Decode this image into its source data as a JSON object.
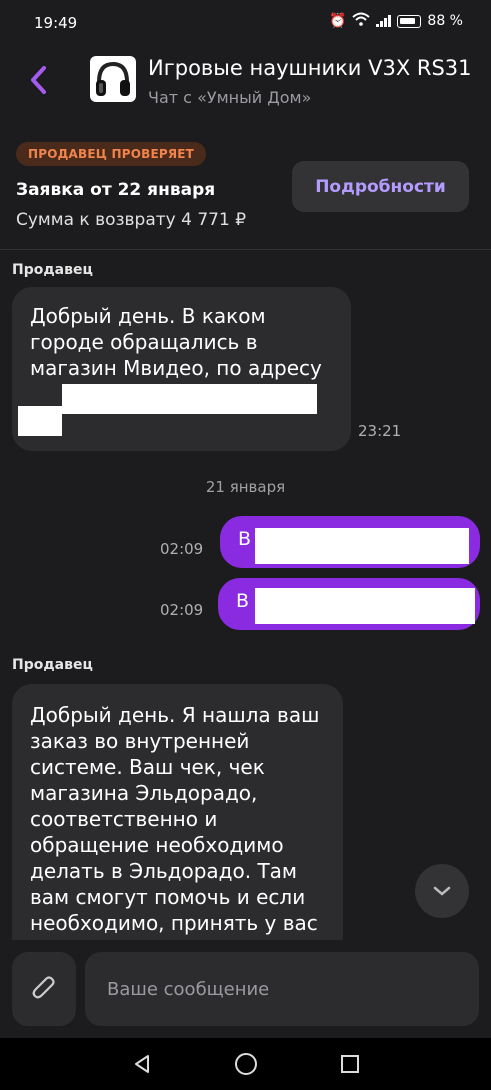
{
  "status_bar": {
    "time": "19:49",
    "battery": "88 %"
  },
  "header": {
    "title": "Игровые наушники V3X RS31",
    "subtitle": "Чат с «Умный Дом»"
  },
  "claim": {
    "badge": "ПРОДАВЕЦ ПРОВЕРЯЕТ",
    "title": "Заявка от 22 января",
    "refund": "Сумма к возврату 4 771 ₽",
    "details_label": "Подробности"
  },
  "messages": {
    "m1": {
      "sender": "Продавец",
      "lines": [
        "Добрый день. В каком",
        "городе обращались в",
        "магазин Мвидео, по адресу",
        "?"
      ],
      "time": "23:21"
    },
    "date_separator": "21 января",
    "m2": {
      "text": "В",
      "time": "02:09"
    },
    "m3": {
      "text": "В",
      "time": "02:09"
    },
    "m4": {
      "sender": "Продавец",
      "lines": [
        "Добрый день. Я нашла ваш",
        "заказ во внутренней",
        "системе. Ваш чек, чек",
        "магазина Эльдорадо,",
        "соответственно и",
        "обращение необходимо",
        "делать в Эльдорадо. Там",
        "вам смогут помочь и если",
        "необходимо, принять у вас"
      ]
    }
  },
  "composer": {
    "placeholder": "Ваше сообщение"
  },
  "colors": {
    "accent": "#8a2be2",
    "badge_text": "#f0844c",
    "link": "#b49cff"
  }
}
